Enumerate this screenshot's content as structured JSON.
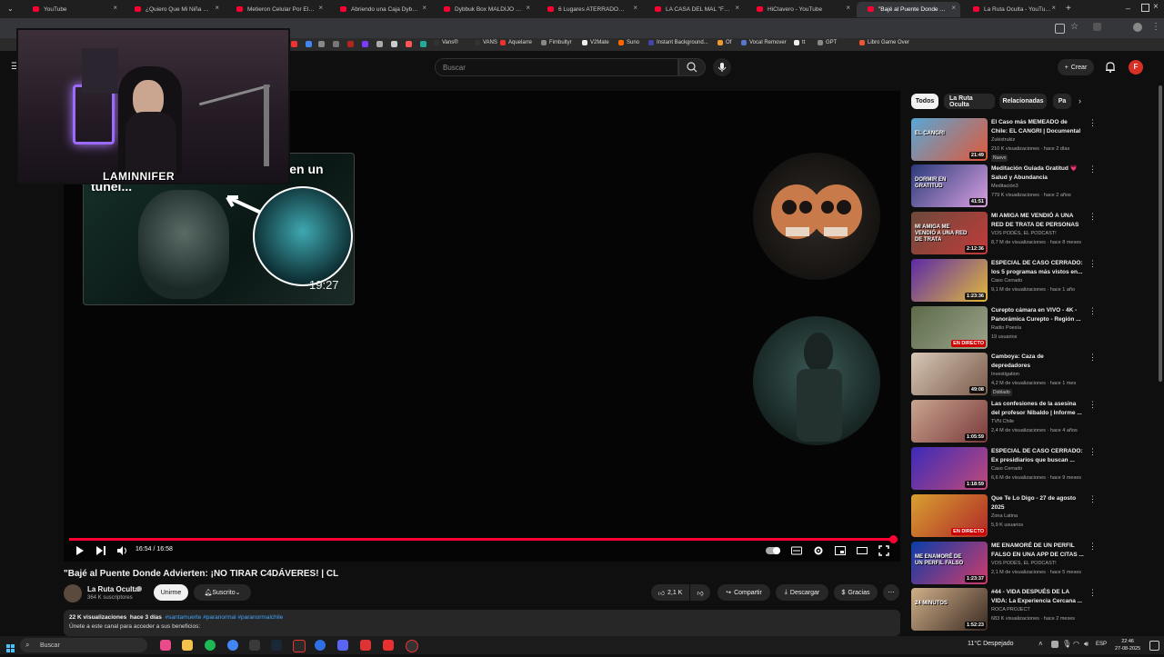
{
  "browser": {
    "tabs": [
      {
        "title": "YouTube",
        "active": false
      },
      {
        "title": "¿Quiero Que Mi Niña Sea Una...",
        "active": false
      },
      {
        "title": "Metieron Celular Por El Ano...",
        "active": false
      },
      {
        "title": "Abriendo una Caja Dybbuk M...",
        "active": false
      },
      {
        "title": "Dybbuk Box MALDIJO mi HO...",
        "active": false
      },
      {
        "title": "6 Lugares ATERRADORES en c...",
        "active": false
      },
      {
        "title": "LA CASA DEL MAL \"Fue Malva...",
        "active": false
      },
      {
        "title": "HiCIavero - YouTube",
        "active": false
      },
      {
        "title": "\"Bajé al Puente Donde Advier...",
        "active": true
      },
      {
        "title": "La Ruta Oculta - YouTube",
        "active": false
      }
    ],
    "new_tab": "+",
    "bookmarks": [
      "Vans®",
      "VANS",
      "Aquelarre",
      "Fimbultyr",
      "V2Mate",
      "Suno",
      "Instant Background...",
      "Of",
      "Vocal Remover",
      "tt",
      "GPT",
      "Libro Game Over"
    ],
    "colors": {
      "accent": "#ff0033",
      "tabbar": "#1f1f1f",
      "active_tab": "#35363a"
    }
  },
  "header": {
    "search_placeholder": "Buscar",
    "create_label": "Crear",
    "avatar_letter": "F"
  },
  "player": {
    "overlay_card_title": "\"...che! Esto fue lo que encontré en un túnel...",
    "overlay_card_time": "19:27",
    "webcam_name": "LAMINNIFER",
    "time_display": "16:54 / 16:58",
    "progress": 0.998
  },
  "video": {
    "title": "\"Bajé al Puente Donde Advierten: ¡NO TIRAR C4DÁVERES! | CL",
    "channel_name": "La Ruta Oculta",
    "subscribers": "364 K suscriptores",
    "join_label": "Unirme",
    "subscribed_label": "Suscrito",
    "likes": "2,1 K",
    "share_label": "Compartir",
    "download_label": "Descargar",
    "thanks_label": "Gracias",
    "views": "22 K visualizaciones",
    "age": "hace 3 días",
    "tags": "#santamuerte #paranormal #paranormalchile",
    "desc_line": "Únete a este canal para acceder a sus beneficios:"
  },
  "sidebar": {
    "chips": [
      "Todos",
      "La Ruta Oculta",
      "Relacionadas",
      "Pa"
    ],
    "items": [
      {
        "title": "El Caso más MEMEADO de Chile: EL CANGRI | Documental",
        "channel": "Zukistrukiz",
        "meta": "210 K visualizaciones · hace 2 días",
        "duration": "21:49",
        "badge": "Nuevo",
        "thumb_text": "EL CANGRI"
      },
      {
        "title": "Meditación Guiada Gratitud 💗 Salud y Abundancia",
        "channel": "Meditación3",
        "meta": "779 K visualizaciones · hace 2 años",
        "duration": "41:51",
        "badge": "",
        "thumb_text": "DORMIR EN GRATITUD"
      },
      {
        "title": "MI AMIGA ME VENDIÓ A UNA RED DE TRATA DE PERSONAS ...",
        "channel": "VOS PODÉS, EL PODCAST!",
        "meta": "8,7 M de visualizaciones · hace 8 meses",
        "duration": "2:12:36",
        "badge": "",
        "thumb_text": "MI AMIGA ME VENDIÓ A UNA RED DE TRATA"
      },
      {
        "title": "ESPECIAL DE CASO CERRADO: los 5 programas más vistos en...",
        "channel": "Caso Cerrado",
        "meta": "9,1 M de visualizaciones · hace 1 año",
        "duration": "1:23:36",
        "badge": "",
        "thumb_text": ""
      },
      {
        "title": "Curepto cámara en VIVO - 4K - Panorámica Curepto - Región ...",
        "channel": "Radio Poesía",
        "meta": "19 usuarios",
        "duration": "EN DIRECTO",
        "badge": "",
        "thumb_text": ""
      },
      {
        "title": "Camboya: Caza de depredadores",
        "channel": "Investigation",
        "meta": "4,2 M de visualizaciones · hace 1 mes",
        "duration": "49:08",
        "badge": "Doblado",
        "thumb_text": ""
      },
      {
        "title": "Las confesiones de la asesina del profesor Nibaldo | Informe ...",
        "channel": "TVN Chile",
        "meta": "2,4 M de visualizaciones · hace 4 años",
        "duration": "1:05:59",
        "badge": "",
        "thumb_text": ""
      },
      {
        "title": "ESPECIAL DE CASO CERRADO: Ex presidiarios que buscan ...",
        "channel": "Caso Cerrado",
        "meta": "6,6 M de visualizaciones · hace 9 meses",
        "duration": "1:18:59",
        "badge": "",
        "thumb_text": ""
      },
      {
        "title": "Que Te Lo Digo - 27 de agosto 2025",
        "channel": "Zona Latina",
        "meta": "5,9 K usuarios",
        "duration": "EN DIRECTO",
        "badge": "",
        "thumb_text": ""
      },
      {
        "title": "ME ENAMORÉ DE UN PERFIL FALSO EN UNA APP DE CITAS ...",
        "channel": "VOS PODÉS, EL PODCAST!",
        "meta": "2,1 M de visualizaciones · hace 5 meses",
        "duration": "1:23:37",
        "badge": "",
        "thumb_text": "ME ENAMORÉ DE UN PERFIL FALSO"
      },
      {
        "title": "#44 - VIDA DESPUÉS DE LA VIDA: La Experiencia Cercana ...",
        "channel": "ROCA PROJECT",
        "meta": "683 K visualizaciones · hace 2 meses",
        "duration": "1:52:23",
        "badge": "",
        "thumb_text": "24 MINUTOS"
      }
    ]
  },
  "taskbar": {
    "search_label": "Buscar",
    "weather": "11°C  Despejado",
    "lang": "ESP",
    "time": "22:46",
    "date": "27-08-2025"
  }
}
